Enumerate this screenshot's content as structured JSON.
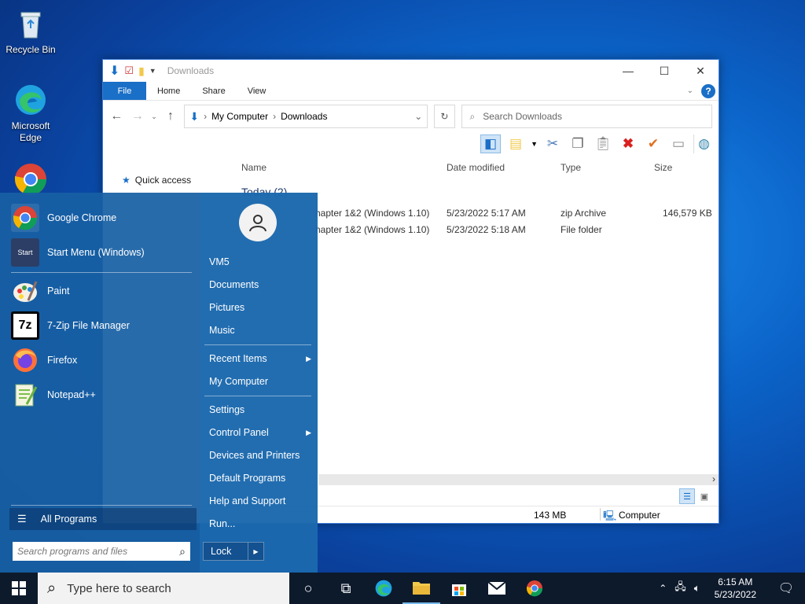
{
  "desktop": {
    "icons": [
      {
        "label": "Recycle Bin",
        "icon": "recycle-bin-icon"
      },
      {
        "label": "Microsoft Edge",
        "icon": "edge-icon"
      },
      {
        "label": "",
        "icon": "chrome-icon"
      }
    ]
  },
  "explorer": {
    "title": "Downloads",
    "tabs": [
      "File",
      "Home",
      "Share",
      "View"
    ],
    "breadcrumb": [
      "My Computer",
      "Downloads"
    ],
    "search_placeholder": "Search Downloads",
    "quick_access": "Quick access",
    "columns": [
      "Name",
      "Date modified",
      "Type",
      "Size"
    ],
    "group": "Today (2)",
    "files": [
      {
        "name": "hapter 1&2 (Windows 1.10)",
        "date": "5/23/2022 5:17 AM",
        "type": "zip Archive",
        "size": "146,579 KB"
      },
      {
        "name": "hapter 1&2 (Windows 1.10)",
        "date": "5/23/2022 5:18 AM",
        "type": "File folder",
        "size": ""
      }
    ],
    "status_size": "143 MB",
    "status_location": "Computer"
  },
  "startmenu": {
    "programs": [
      {
        "label": "Google Chrome",
        "icon": "chrome-icon"
      },
      {
        "label": "Start Menu (Windows)",
        "icon": "start-menu-icon",
        "icon_text": "Start"
      },
      {
        "label": "Paint",
        "icon": "paint-icon"
      },
      {
        "label": "7-Zip File Manager",
        "icon": "seven-zip-icon",
        "icon_text": "7z"
      },
      {
        "label": "Firefox",
        "icon": "firefox-icon"
      },
      {
        "label": "Notepad++",
        "icon": "notepad-plus-icon"
      }
    ],
    "all_programs": "All Programs",
    "search_placeholder": "Search programs and files",
    "right_items": [
      {
        "label": "VM5"
      },
      {
        "label": "Documents"
      },
      {
        "label": "Pictures"
      },
      {
        "label": "Music"
      },
      {
        "label": "Recent Items",
        "submenu": true
      },
      {
        "label": "My Computer"
      },
      {
        "label": "Settings"
      },
      {
        "label": "Control Panel",
        "submenu": true
      },
      {
        "label": "Devices and Printers"
      },
      {
        "label": "Default Programs"
      },
      {
        "label": "Help and Support"
      },
      {
        "label": "Run..."
      }
    ],
    "lock_label": "Lock"
  },
  "taskbar": {
    "search_placeholder": "Type here to search",
    "time": "6:15 AM",
    "date": "5/23/2022"
  },
  "colors": {
    "accent": "#1a6fc7",
    "startmenu_bg": "#1860a4",
    "taskbar_bg": "#0d1a2c"
  }
}
